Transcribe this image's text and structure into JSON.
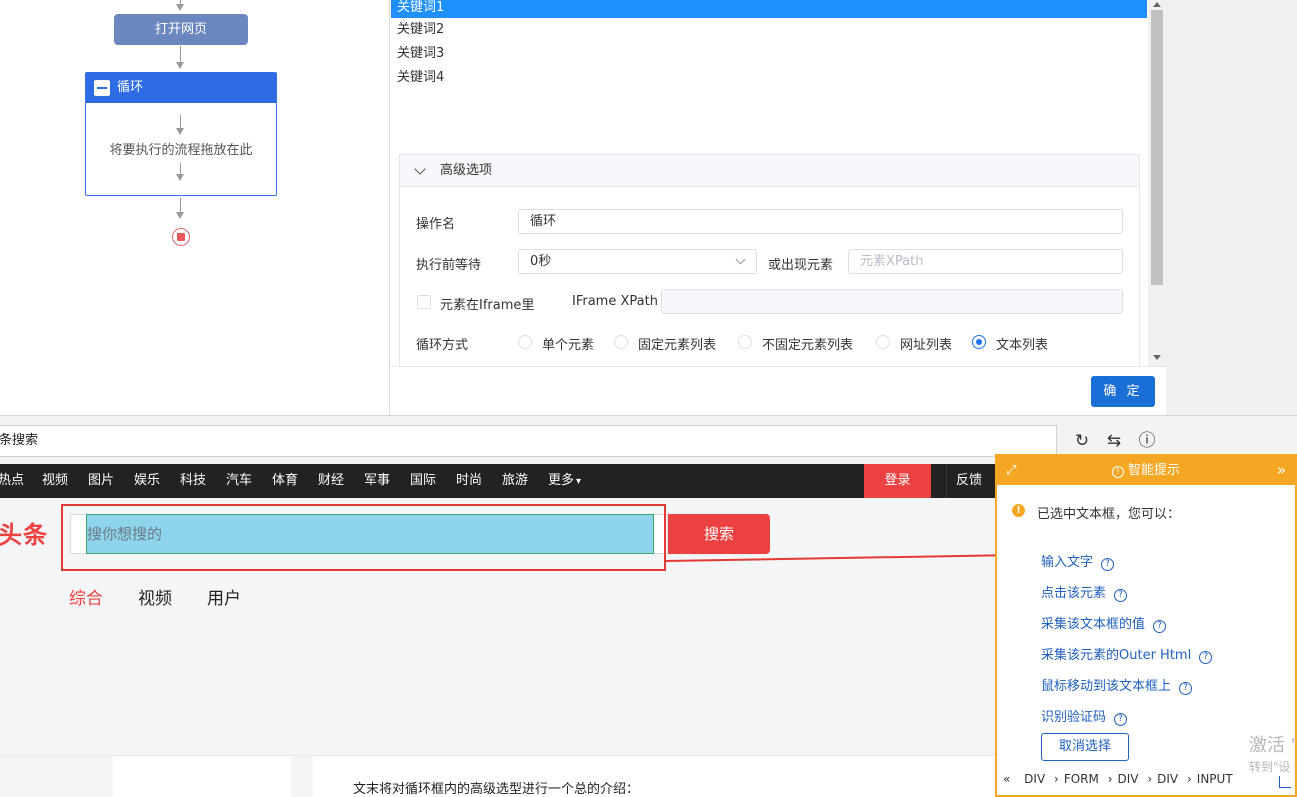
{
  "flow": {
    "open_page_label": "打开网页",
    "loop_label": "循环",
    "loop_hint": "将要执行的流程拖放在此"
  },
  "keywords": [
    "关键词1",
    "关键词2",
    "关键词3",
    "关键词4"
  ],
  "advanced": {
    "title": "高级选项",
    "op_name_label": "操作名",
    "op_name_value": "循环",
    "wait_label": "执行前等待",
    "wait_value": "0秒",
    "or_element_label": "或出现元素",
    "xpath_placeholder": "元素XPath",
    "iframe_label": "元素在Iframe里",
    "iframe_xpath_label": "IFrame XPath",
    "loop_mode_label": "循环方式",
    "loop_modes": [
      "单个元素",
      "固定元素列表",
      "不固定元素列表",
      "网址列表",
      "文本列表"
    ],
    "selected_mode": "文本列表"
  },
  "ok_label": "确 定",
  "browser": {
    "address_text": "条搜索"
  },
  "toutiao": {
    "nav": [
      "热点",
      "视频",
      "图片",
      "娱乐",
      "科技",
      "汽车",
      "体育",
      "财经",
      "军事",
      "国际",
      "时尚",
      "旅游",
      "更多"
    ],
    "login": "登录",
    "feedback": "反馈",
    "logo": "头条",
    "search_placeholder": "搜你想搜的",
    "search_button": "搜索",
    "tabs": [
      "综合",
      "视频",
      "用户"
    ],
    "intro": "文末将对循环框内的高级选型进行一个总的介绍："
  },
  "tip": {
    "title": "智能提示",
    "selected_note": "已选中文本框，您可以：",
    "actions": [
      "输入文字",
      "点击该元素",
      "采集该文本框的值",
      "采集该元素的Outer Html",
      "鼠标移动到该文本框上",
      "识别验证码"
    ],
    "cancel": "取消选择",
    "crumbs": [
      "DIV",
      "FORM",
      "DIV",
      "DIV",
      "INPUT"
    ],
    "watermark1": "激活 '",
    "watermark2": "转到\"设"
  },
  "colors": {
    "accent_blue": "#1a6fd6",
    "toutiao_red": "#ed4040",
    "tip_orange": "#f5a623",
    "selection_highlight": "#8ed4ec"
  }
}
